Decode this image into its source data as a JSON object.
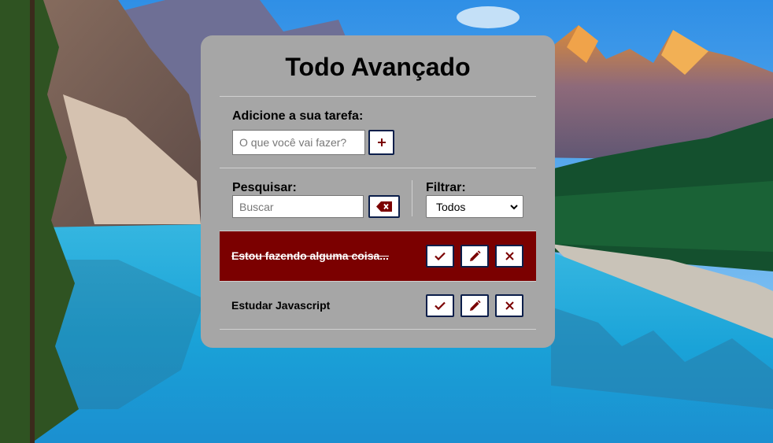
{
  "app": {
    "title": "Todo Avançado"
  },
  "add_section": {
    "label": "Adicione a sua tarefa:",
    "placeholder": "O que você vai fazer?",
    "value": "",
    "add_button_label": "+"
  },
  "search_section": {
    "label": "Pesquisar:",
    "placeholder": "Buscar",
    "value": ""
  },
  "filter_section": {
    "label": "Filtrar:",
    "selected": "Todos"
  },
  "todos": [
    {
      "text": "Estou fazendo alguma coisa...",
      "done": true
    },
    {
      "text": "Estudar Javascript",
      "done": false
    }
  ],
  "colors": {
    "card_bg": "#a6a6a6",
    "accent": "#7b0000",
    "button_border": "#0b1e4a"
  },
  "icons": {
    "add": "plus-icon",
    "clear_search": "backspace-icon",
    "finish": "check-icon",
    "edit": "pencil-icon",
    "remove": "x-mark-icon",
    "select": "chevron-down-icon"
  }
}
